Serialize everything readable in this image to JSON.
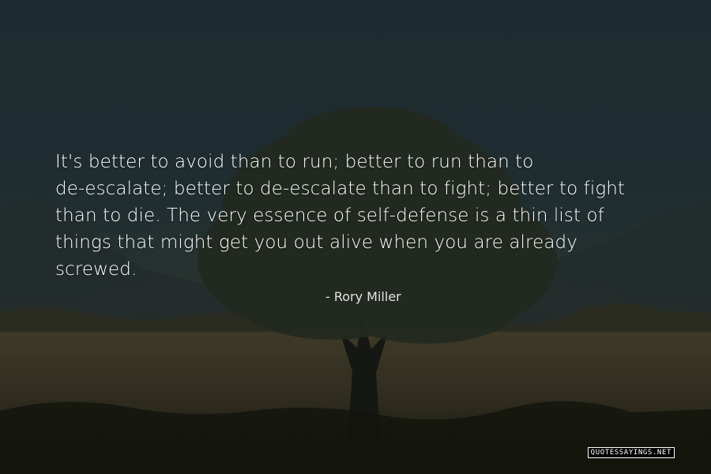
{
  "quote": {
    "lines": [
      "It's better to avoid than to run; better to run than to",
      "de-escalate; better to de-escalate than to fight; better to fight",
      "than to die. The very essence of self-defense is a thin list of",
      "things that might get you out alive when you are already",
      "screwed."
    ],
    "author": "- Rory Miller"
  },
  "watermark": "QUOTESSAYINGS.NET",
  "colors": {
    "sky": "#1d2b30",
    "foliage": "#262d22",
    "field": "#3a3423",
    "text": "#ffffff"
  }
}
